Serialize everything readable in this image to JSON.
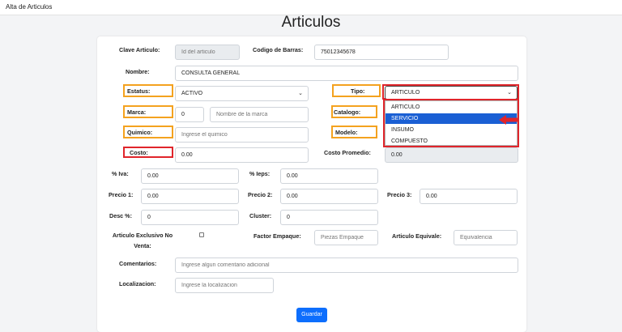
{
  "window": {
    "title": "Alta de Articulos"
  },
  "page": {
    "heading": "Articulos"
  },
  "fields": {
    "clave": {
      "label": "Clave Articulo:",
      "placeholder": "Id del articulo"
    },
    "codigo_barras": {
      "label": "Codigo de Barras:",
      "value": "75012345678"
    },
    "nombre": {
      "label": "Nombre:",
      "value": "CONSULTA GENERAL"
    },
    "estatus": {
      "label": "Estatus:",
      "value": "ACTIVO"
    },
    "tipo": {
      "label": "Tipo:",
      "value": "ARTICULO",
      "options": [
        "ARTICULO",
        "SERVICIO",
        "INSUMO",
        "COMPUESTO"
      ],
      "highlighted": "SERVICIO"
    },
    "marca": {
      "label": "Marca:",
      "value": "0",
      "placeholder": "Nombre de la marca"
    },
    "catalogo": {
      "label": "Catalogo:"
    },
    "quimico": {
      "label": "Quimico:",
      "placeholder": "Ingrese el quimico"
    },
    "modelo": {
      "label": "Modelo:"
    },
    "costo": {
      "label": "Costo:",
      "value": "0.00"
    },
    "costo_promedio": {
      "label": "Costo Promedio:",
      "value": "0.00"
    },
    "iva": {
      "label": "% Iva:",
      "value": "0.00"
    },
    "ieps": {
      "label": "% Ieps:",
      "value": "0.00"
    },
    "precio1": {
      "label": "Precio 1:",
      "value": "0.00"
    },
    "precio2": {
      "label": "Precio 2:",
      "value": "0.00"
    },
    "precio3": {
      "label": "Precio 3:",
      "value": "0.00"
    },
    "desc": {
      "label": "Desc %:",
      "value": "0"
    },
    "cluster": {
      "label": "Cluster:",
      "value": "0"
    },
    "exclusivo": {
      "label_line1": "Articulo Exclusivo No",
      "label_line2": "Venta:"
    },
    "factor_empaque": {
      "label": "Factor Empaque:",
      "placeholder": "Piezas Empaque"
    },
    "articulo_equivale": {
      "label": "Articulo Equivale:",
      "placeholder": "Equivalencia"
    },
    "comentarios": {
      "label": "Comentarios:",
      "placeholder": "Ingrese algun comentario adicional"
    },
    "localizacion": {
      "label": "Localizacion:",
      "placeholder": "Ingrese la localizacion"
    }
  },
  "actions": {
    "save_label": "Guardar"
  },
  "colors": {
    "highlight_orange": "#f4a21f",
    "highlight_red": "#e0252b",
    "primary": "#0d6efd",
    "dropdown_active": "#1a5fd4"
  },
  "icons": {
    "select_chevron": "chevron-down-icon",
    "pointer_arrow": "red-arrow-icon"
  }
}
